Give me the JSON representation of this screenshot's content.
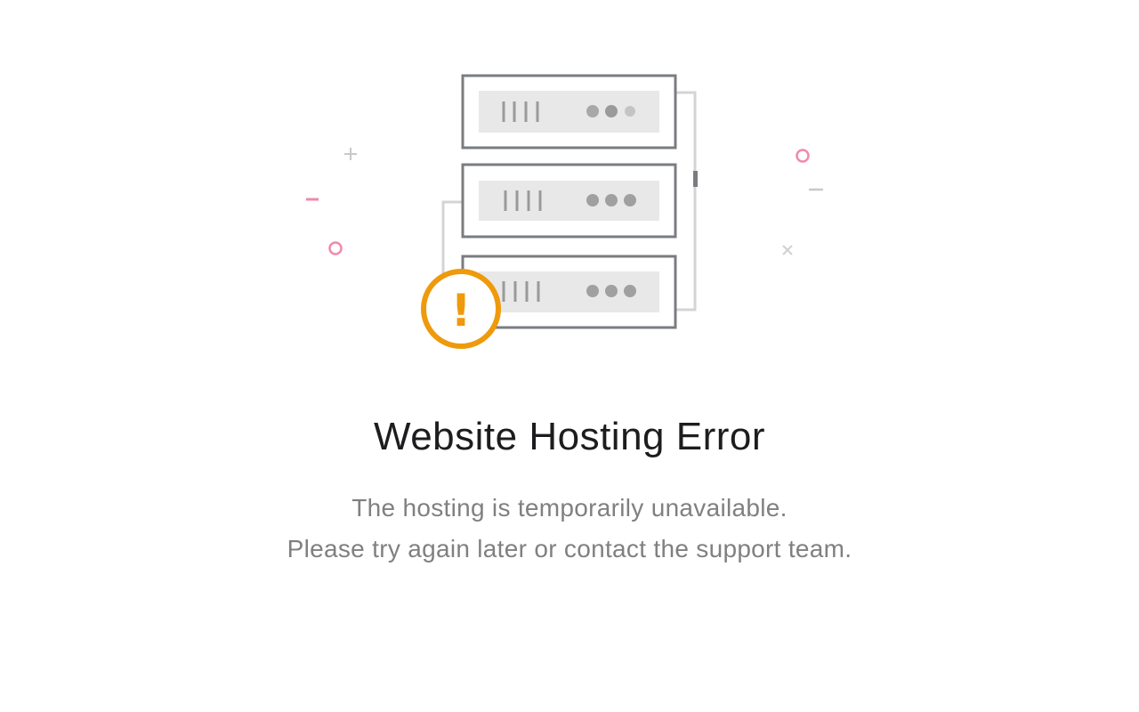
{
  "error": {
    "title": "Website Hosting Error",
    "message_line1": "The hosting is temporarily unavailable.",
    "message_line2": "Please try again later or contact the support team.",
    "alert_symbol": "!"
  },
  "illustration": {
    "icon": "server-rack-icon",
    "alert_icon": "exclamation-alert-icon",
    "colors": {
      "alert": "#ee9a0c",
      "accent_pink": "#f08aaa",
      "outline": "#7a7d80",
      "panel": "#e8e8e8",
      "line": "#d4d4d4"
    }
  }
}
